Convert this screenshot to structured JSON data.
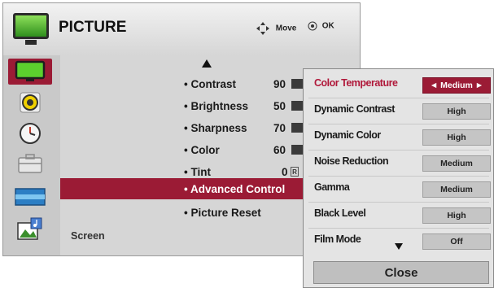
{
  "header": {
    "title": "PICTURE",
    "move_label": "Move",
    "ok_label": "OK"
  },
  "sidebar": {
    "items": [
      {
        "icon": "picture-tv-icon",
        "active": true
      },
      {
        "icon": "speaker-icon"
      },
      {
        "icon": "clock-icon"
      },
      {
        "icon": "toolbox-icon"
      },
      {
        "icon": "screen-aspect-icon"
      },
      {
        "icon": "media-icon"
      }
    ],
    "current_label": "Screen"
  },
  "menu": {
    "items": [
      {
        "label": "• Contrast",
        "value": "90"
      },
      {
        "label": "• Brightness",
        "value": "50"
      },
      {
        "label": "• Sharpness",
        "value": "70"
      },
      {
        "label": "• Color",
        "value": "60"
      },
      {
        "label": "• Tint",
        "value": "0",
        "badge": "R"
      },
      {
        "label": "• Advanced Control",
        "selected": true
      },
      {
        "label": "• Picture Reset"
      }
    ]
  },
  "submenu": {
    "items": [
      {
        "label": "Color Temperature",
        "value": "◄  Medium  ►",
        "selected": true
      },
      {
        "label": "Dynamic Contrast",
        "value": "High"
      },
      {
        "label": "Dynamic Color",
        "value": "High"
      },
      {
        "label": "Noise Reduction",
        "value": "Medium"
      },
      {
        "label": "Gamma",
        "value": "Medium"
      },
      {
        "label": "Black Level",
        "value": "High"
      },
      {
        "label": "Film Mode",
        "value": "Off"
      }
    ],
    "close_label": "Close"
  },
  "colors": {
    "accent": "#9b1b35",
    "selected_text": "#b0183a"
  }
}
